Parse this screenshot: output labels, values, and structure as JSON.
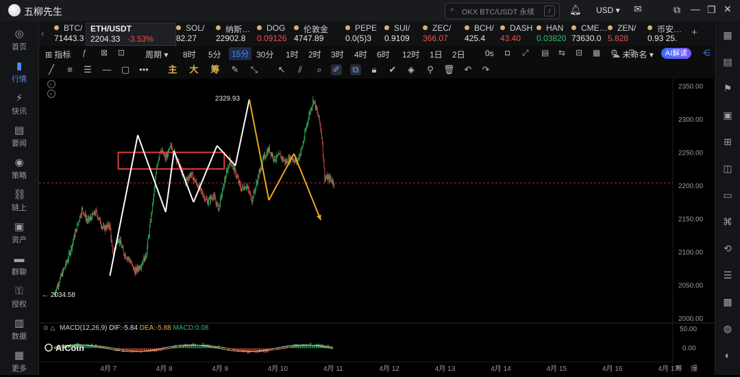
{
  "app": {
    "title": "五柳先生"
  },
  "search": {
    "placeholder": "OKX BTC/USDT 永续",
    "shortcut": "/"
  },
  "titlebar": {
    "currency": "USD"
  },
  "leftnav": [
    {
      "label": "首页",
      "icon": "home-icon"
    },
    {
      "label": "行情",
      "icon": "chart-bars-icon",
      "active": true
    },
    {
      "label": "快讯",
      "icon": "flash-icon"
    },
    {
      "label": "要闻",
      "icon": "news-icon"
    },
    {
      "label": "策略",
      "icon": "robot-icon"
    },
    {
      "label": "链上",
      "icon": "chain-icon"
    },
    {
      "label": "资产",
      "icon": "wallet-icon"
    },
    {
      "label": "群聊",
      "icon": "chat-icon"
    },
    {
      "label": "授权",
      "icon": "key-icon"
    },
    {
      "label": "数据",
      "icon": "data-icon"
    },
    {
      "label": "更多",
      "icon": "more-icon"
    }
  ],
  "tickers": [
    {
      "name": "BTC/",
      "price": "71443.3"
    },
    {
      "name": "ETH/USDT",
      "price": "2204.33",
      "change": "-3.53%",
      "active": true
    },
    {
      "name": "SOL/",
      "price": "82.27"
    },
    {
      "name": "纳斯…",
      "price": "22902.8"
    },
    {
      "name": "DOG",
      "price": "0.09126",
      "dir": "dn"
    },
    {
      "name": "伦敦金",
      "price": "4747.89"
    },
    {
      "name": "PEPE",
      "price": "0.0(5)3"
    },
    {
      "name": "SUI/",
      "price": "0.9109"
    },
    {
      "name": "ZEC/",
      "price": "366.07",
      "dir": "dn"
    },
    {
      "name": "BCH/",
      "price": "425.4"
    },
    {
      "name": "DASH",
      "price": "43.40",
      "dir": "dn"
    },
    {
      "name": "HAN",
      "price": "0.03820",
      "dir": "up"
    },
    {
      "name": "CME…",
      "price": "73630.0"
    },
    {
      "name": "ZEN/",
      "price": "5.828",
      "dir": "dn"
    },
    {
      "name": "币安…",
      "price": "0.93 25."
    }
  ],
  "toolbar": {
    "indicator": "指标",
    "period": "周期",
    "timeframes": [
      "8时",
      "5分",
      "15分",
      "30分",
      "1时",
      "2时",
      "3时",
      "4时",
      "6时",
      "12时",
      "1日",
      "2日",
      "0s"
    ],
    "selected_timeframe": "15分",
    "layout_name": "未命名",
    "ai_label": "AI解读",
    "draw_labels": [
      "主",
      "大",
      "筹"
    ]
  },
  "chart_data": {
    "type": "candlestick",
    "symbol": "ETH/USDT",
    "timeframe": "15分",
    "y_ticks": [
      2000,
      2050,
      2100,
      2150,
      2200,
      2250,
      2300,
      2350
    ],
    "y_tick_labels": [
      "2000.00",
      "2050.00",
      "2100.00",
      "2150.00",
      "2200.00",
      "2250.00",
      "2300.00",
      "2350.00"
    ],
    "ylim": [
      1995,
      2361
    ],
    "x_ticks": [
      "4月 7",
      "4月 8",
      "4月 9",
      "4月 10",
      "4月 11",
      "4月 12",
      "4月 13",
      "4月 14",
      "4月 15",
      "4月 16",
      "4月 17"
    ],
    "x_tail_labels": [
      "筹",
      "爆"
    ],
    "high_label": "2329.93",
    "low_label": "← 2034.58",
    "reference_line": 2204,
    "close_path": [
      [
        0,
        2036
      ],
      [
        0.12,
        2062
      ],
      [
        0.25,
        2090
      ],
      [
        0.35,
        2120
      ],
      [
        0.5,
        2165
      ],
      [
        0.6,
        2146
      ],
      [
        0.75,
        2160
      ],
      [
        0.88,
        2135
      ],
      [
        1.0,
        2140
      ],
      [
        1.05,
        2095
      ],
      [
        1.15,
        2122
      ],
      [
        1.25,
        2098
      ],
      [
        1.35,
        2088
      ],
      [
        1.45,
        2070
      ],
      [
        1.55,
        2080
      ],
      [
        1.65,
        2095
      ],
      [
        1.75,
        2160
      ],
      [
        1.85,
        2232
      ],
      [
        1.9,
        2255
      ],
      [
        2.0,
        2240
      ],
      [
        2.1,
        2260
      ],
      [
        2.2,
        2240
      ],
      [
        2.35,
        2206
      ],
      [
        2.45,
        2218
      ],
      [
        2.6,
        2196
      ],
      [
        2.75,
        2175
      ],
      [
        2.85,
        2185
      ],
      [
        2.95,
        2165
      ],
      [
        3.05,
        2205
      ],
      [
        3.15,
        2238
      ],
      [
        3.25,
        2220
      ],
      [
        3.35,
        2195
      ],
      [
        3.45,
        2200
      ],
      [
        3.55,
        2178
      ],
      [
        3.65,
        2210
      ],
      [
        3.75,
        2240
      ],
      [
        3.85,
        2255
      ],
      [
        3.95,
        2240
      ],
      [
        4.05,
        2245
      ],
      [
        4.15,
        2235
      ],
      [
        4.25,
        2242
      ],
      [
        4.35,
        2235
      ],
      [
        4.45,
        2258
      ],
      [
        4.55,
        2300
      ],
      [
        4.65,
        2330
      ],
      [
        4.75,
        2300
      ],
      [
        4.8,
        2275
      ],
      [
        4.85,
        2212
      ],
      [
        4.95,
        2210
      ],
      [
        5.02,
        2204
      ]
    ],
    "trend_lines_white": [
      [
        [
          1.0,
          2064
        ],
        [
          1.5,
          2276
        ]
      ],
      [
        [
          1.5,
          2276
        ],
        [
          2.0,
          2160
        ]
      ],
      [
        [
          2.0,
          2160
        ],
        [
          2.15,
          2252
        ]
      ],
      [
        [
          2.15,
          2252
        ],
        [
          2.5,
          2175
        ]
      ],
      [
        [
          2.5,
          2175
        ],
        [
          2.92,
          2260
        ]
      ],
      [
        [
          2.92,
          2260
        ],
        [
          3.25,
          2230
        ]
      ],
      [
        [
          3.25,
          2230
        ],
        [
          3.5,
          2330
        ]
      ]
    ],
    "projection_orange": [
      [
        3.5,
        2330
      ],
      [
        3.85,
        2178
      ],
      [
        4.3,
        2248
      ],
      [
        4.78,
        2148
      ]
    ],
    "range_box": [
      1.15,
      3.05,
      2225,
      2250
    ],
    "macd": {
      "label": "MACD(12,26,9)",
      "dif": "DIF:-5.84",
      "dea": "DEA:-5.88",
      "macd": "MACD:0.08",
      "y_ticks": [
        "50.00",
        "0.00"
      ]
    },
    "watermark": "AiCoin"
  }
}
